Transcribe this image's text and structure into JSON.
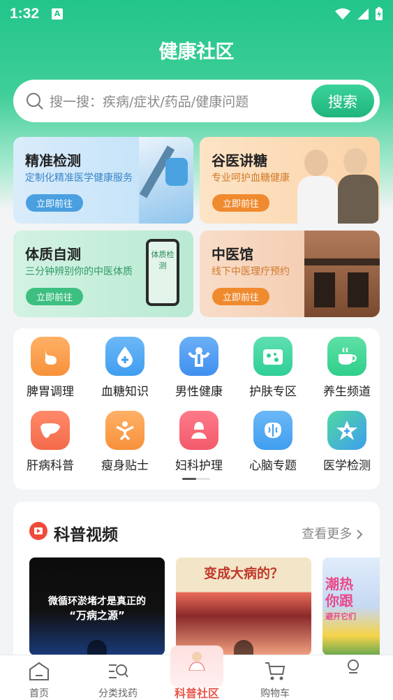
{
  "status": {
    "time": "1:32",
    "a_badge": "A"
  },
  "header": {
    "title": "健康社区"
  },
  "search": {
    "placeholder": "搜一搜：疾病/症状/药品/健康问题",
    "button": "搜索"
  },
  "cards": [
    {
      "title": "精准检测",
      "subtitle": "定制化精准医学健康服务",
      "button": "立即前往"
    },
    {
      "title": "谷医讲糖",
      "subtitle": "专业呵护血糖健康",
      "button": "立即前往"
    },
    {
      "title": "体质自测",
      "subtitle": "三分钟辨别你的中医体质",
      "button": "立即前往",
      "phone_text": "体质检测"
    },
    {
      "title": "中医馆",
      "subtitle": "线下中医理疗预约",
      "button": "立即前往"
    }
  ],
  "categories": [
    {
      "label": "脾胃调理",
      "icon": "stomach-icon",
      "color": "#f7913a"
    },
    {
      "label": "血糖知识",
      "icon": "blood-drop-icon",
      "color": "#3f9ef0"
    },
    {
      "label": "男性健康",
      "icon": "muscle-icon",
      "color": "#3f8ff0"
    },
    {
      "label": "护肤专区",
      "icon": "skin-icon",
      "color": "#2fcf97"
    },
    {
      "label": "养生频道",
      "icon": "tea-cup-icon",
      "color": "#2fcf8a"
    },
    {
      "label": "肝病科普",
      "icon": "liver-icon",
      "color": "#f26a4a"
    },
    {
      "label": "瘦身贴士",
      "icon": "person-icon",
      "color": "#f7913a"
    },
    {
      "label": "妇科护理",
      "icon": "woman-icon",
      "color": "#f25a6a"
    },
    {
      "label": "心脑专题",
      "icon": "brain-icon",
      "color": "#3f9ef0"
    },
    {
      "label": "医学检测",
      "icon": "star-badge-icon",
      "color": "#3f9ef0"
    }
  ],
  "videos": {
    "title": "科普视频",
    "more": "查看更多",
    "items": [
      {
        "caption_line1": "微循环淤堵才是真正的",
        "caption_line2": "“万病之源”"
      },
      {
        "caption_line1": "变成大病的？"
      },
      {
        "caption_line1": "潮热",
        "caption_line2": "你跟",
        "caption_line3": "避开它们"
      }
    ]
  },
  "nav": {
    "items": [
      {
        "label": "首页",
        "icon": "home-icon"
      },
      {
        "label": "分类找药",
        "icon": "category-search-icon"
      },
      {
        "label": "科普社区",
        "icon": "community-icon",
        "active": true
      },
      {
        "label": "购物车",
        "icon": "cart-icon"
      },
      {
        "label": "",
        "icon": "profile-icon"
      }
    ]
  },
  "colors": {
    "brand": "#22c58a",
    "accent_orange": "#f08a2e"
  }
}
